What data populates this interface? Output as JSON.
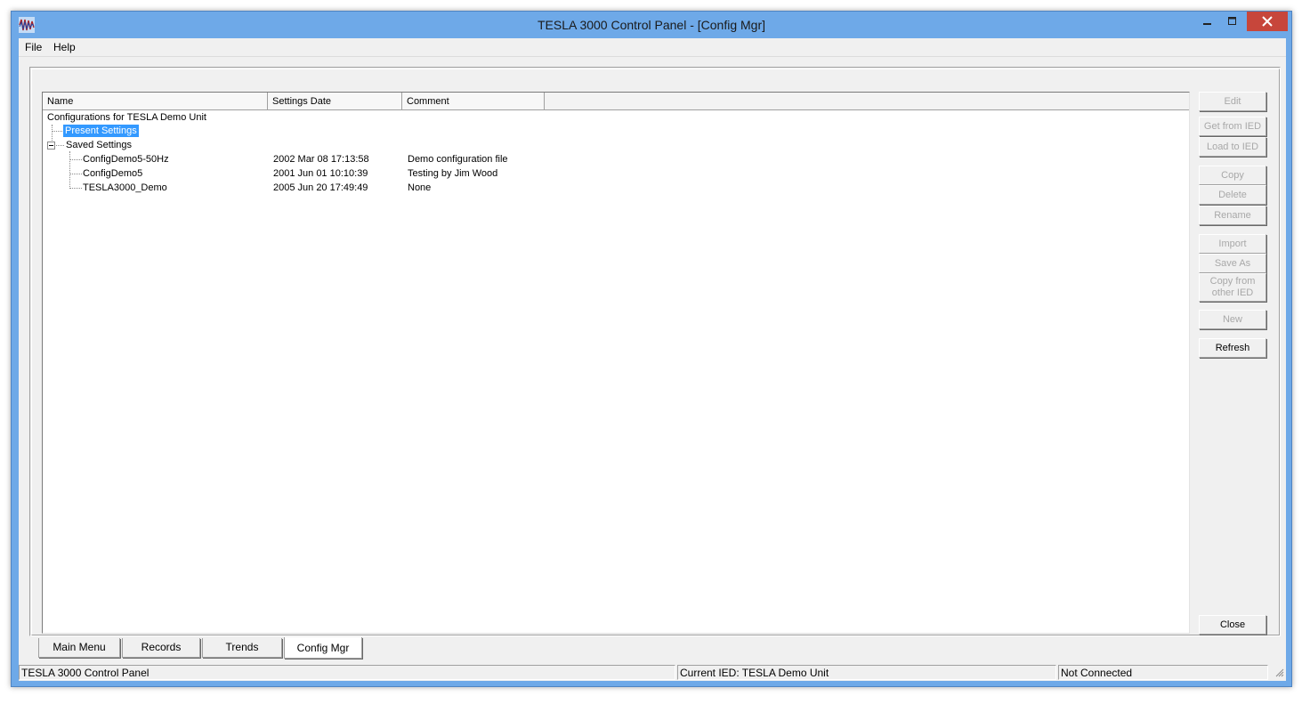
{
  "window": {
    "title": "TESLA 3000 Control Panel - [Config Mgr]",
    "controls": {
      "minimize": "minimize-icon",
      "maximize": "maximize-icon",
      "close": "close-icon"
    },
    "colors": {
      "frame": "#6ea9e8",
      "close": "#c7463b",
      "selection": "#3399ff"
    }
  },
  "menu": {
    "items": [
      "File",
      "Help"
    ]
  },
  "list": {
    "columns": [
      "Name",
      "Settings Date",
      "Comment"
    ],
    "root_label": "Configurations for TESLA Demo Unit",
    "present_settings": "Present Settings",
    "saved_settings": "Saved Settings",
    "rows": [
      {
        "name": "ConfigDemo5-50Hz",
        "date": "2002 Mar 08 17:13:58",
        "comment": "Demo configuration file"
      },
      {
        "name": "ConfigDemo5",
        "date": "2001 Jun 01 10:10:39",
        "comment": "Testing by Jim Wood"
      },
      {
        "name": "TESLA3000_Demo",
        "date": "2005 Jun 20 17:49:49",
        "comment": "None"
      }
    ]
  },
  "buttons": {
    "edit": "Edit",
    "get_from_ied": "Get from IED",
    "load_to_ied": "Load to IED",
    "copy": "Copy",
    "delete": "Delete",
    "rename": "Rename",
    "import": "Import",
    "save_as": "Save As",
    "copy_from_other_line1": "Copy from",
    "copy_from_other_line2": "other IED",
    "new": "New",
    "refresh": "Refresh",
    "close": "Close"
  },
  "tabs": [
    "Main Menu",
    "Records",
    "Trends",
    "Config Mgr"
  ],
  "active_tab": "Config Mgr",
  "status": {
    "app": "TESLA 3000 Control Panel",
    "current_ied": "Current IED:  TESLA Demo Unit",
    "connection": "Not Connected"
  }
}
